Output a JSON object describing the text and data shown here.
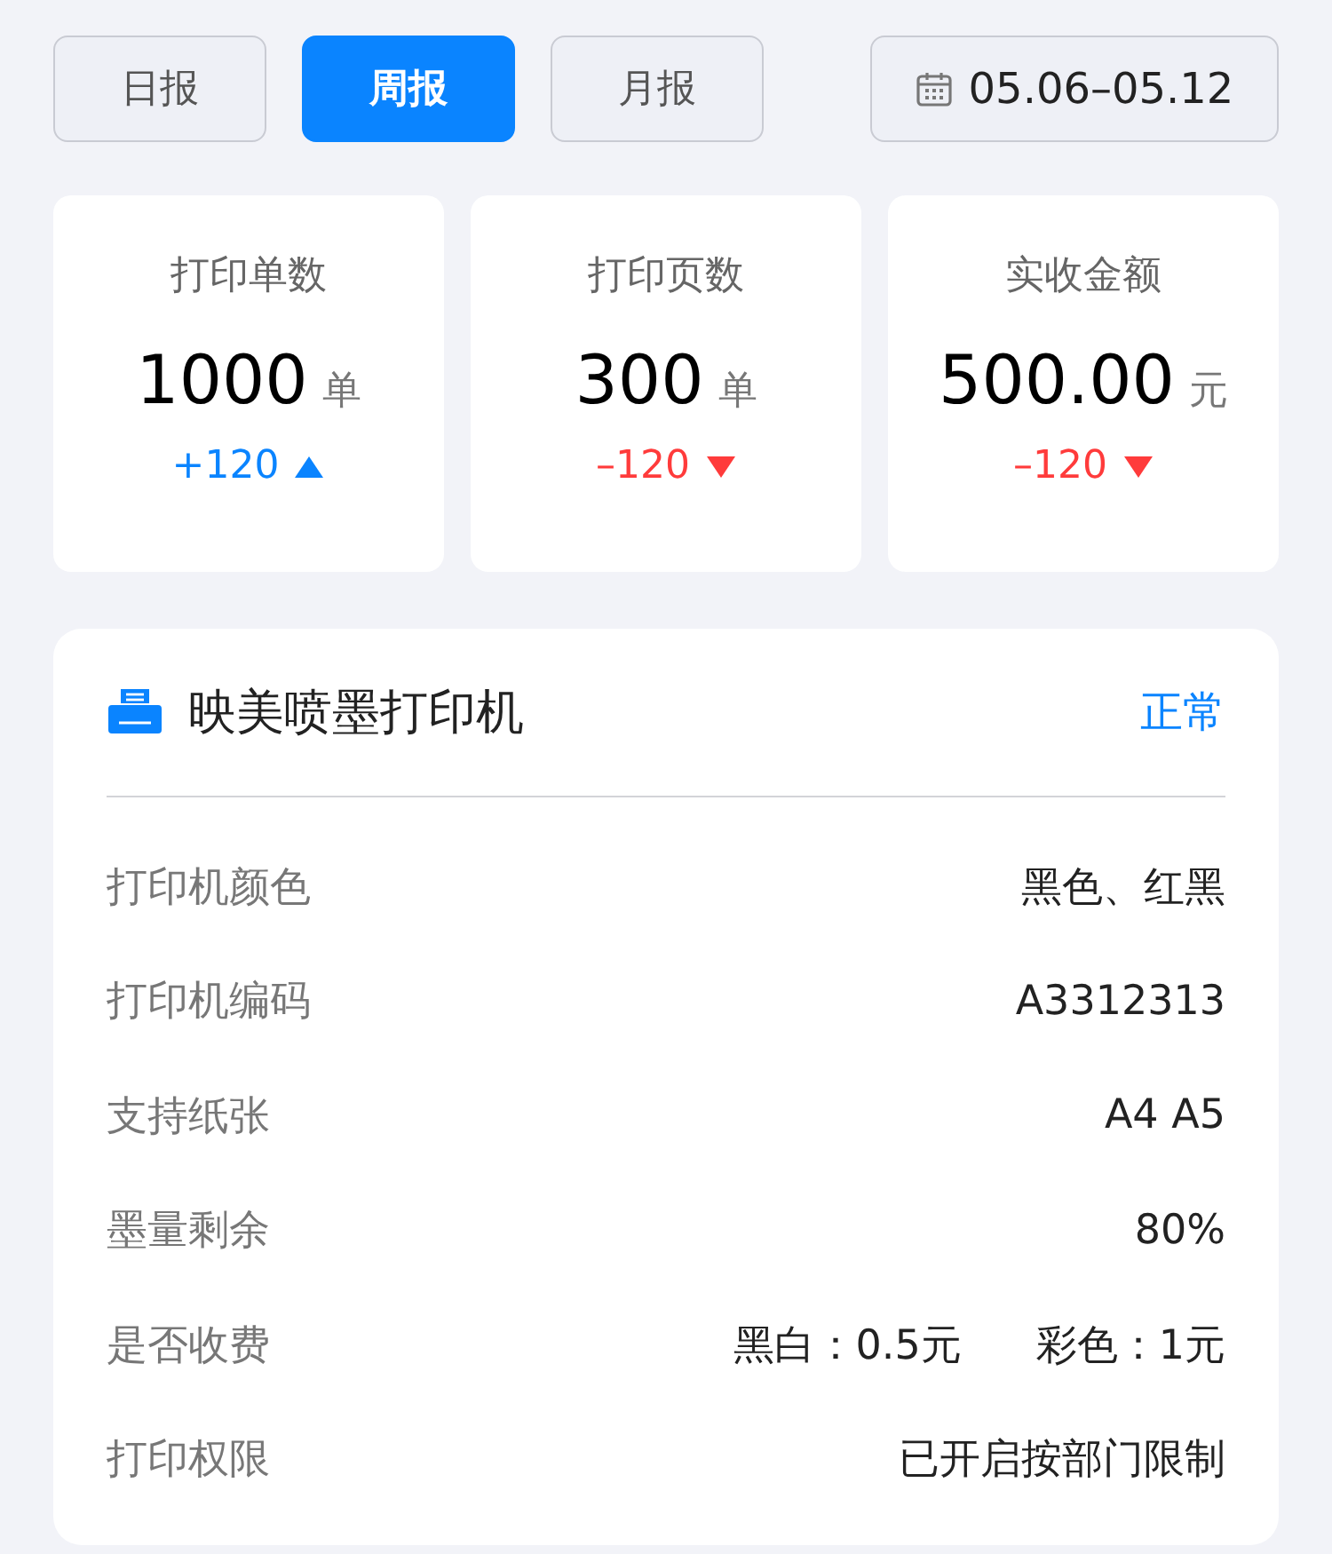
{
  "tabs": [
    {
      "label": "日报",
      "selected": false
    },
    {
      "label": "周报",
      "selected": true
    },
    {
      "label": "月报",
      "selected": false
    }
  ],
  "date_range": "05.06–05.12",
  "stats": [
    {
      "label": "打印单数",
      "value": "1000",
      "unit": "单",
      "change": "+120",
      "kind": "up"
    },
    {
      "label": "打印页数",
      "value": "300",
      "unit": "单",
      "change": "–120",
      "kind": "down"
    },
    {
      "label": "实收金额",
      "value": "500.00",
      "unit": "元",
      "change": "–120",
      "kind": "down"
    }
  ],
  "device": {
    "name": "映美喷墨打印机",
    "status": "正常",
    "rows": [
      {
        "label": "打印机颜色",
        "values": [
          "黑色、红黑"
        ]
      },
      {
        "label": "打印机编码",
        "values": [
          "A3312313"
        ]
      },
      {
        "label": "支持纸张",
        "values": [
          "A4 A5"
        ]
      },
      {
        "label": "墨量剩余",
        "values": [
          "80%"
        ]
      },
      {
        "label": "是否收费",
        "values": [
          "黑白：0.5元",
          "彩色：1元"
        ]
      },
      {
        "label": "打印权限",
        "values": [
          "已开启按部门限制"
        ]
      }
    ]
  }
}
